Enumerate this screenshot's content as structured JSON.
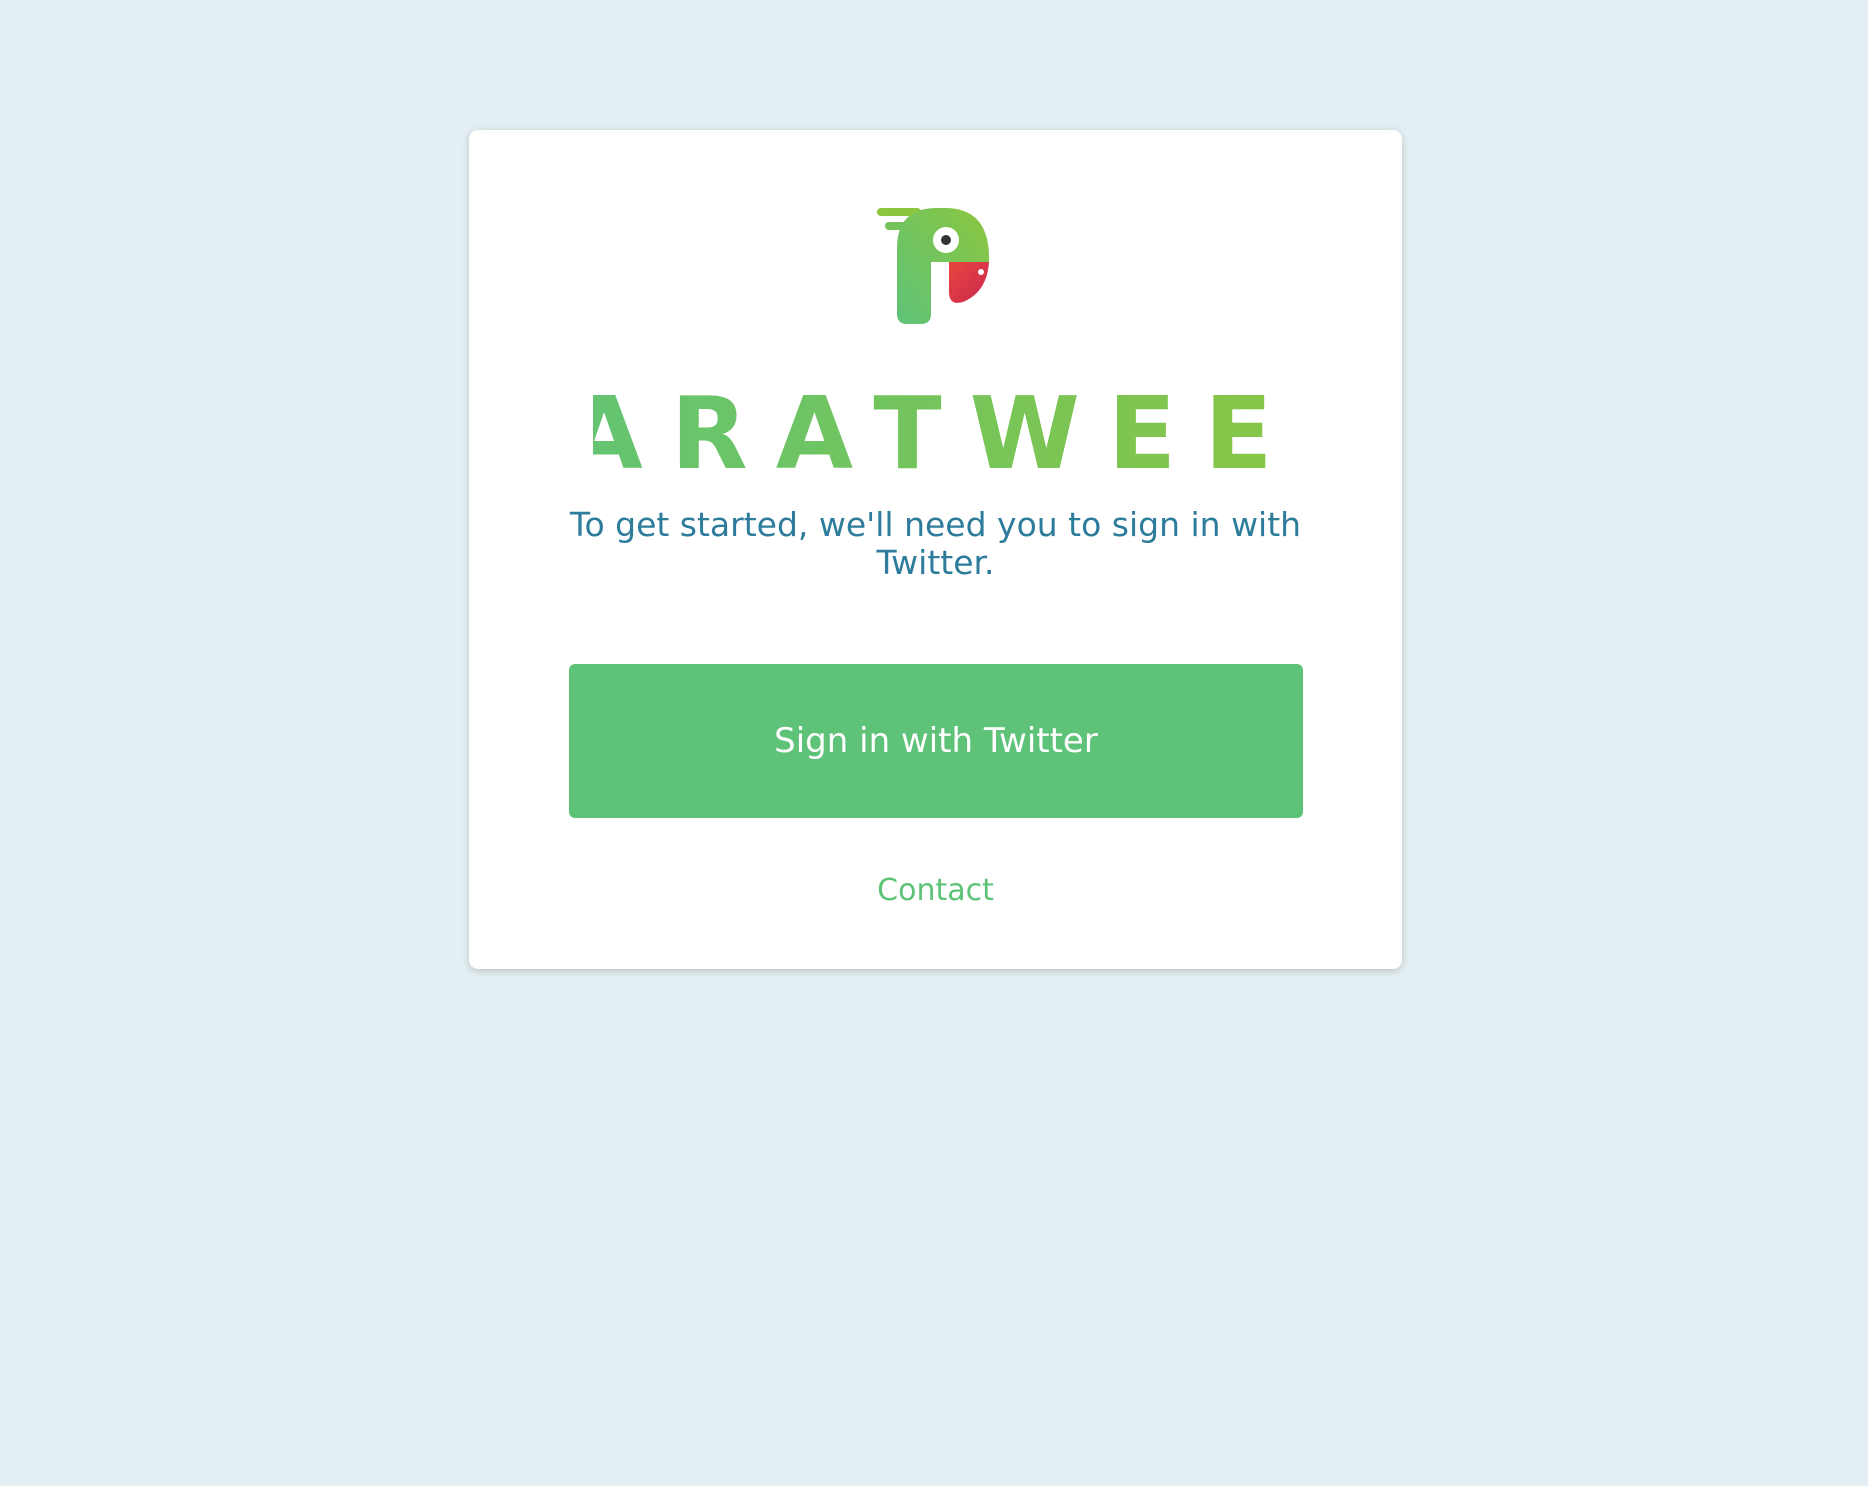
{
  "brand": {
    "name": "PARATWEET",
    "colors": {
      "green": "#5ec378",
      "lime": "#8cc63f",
      "red": "#d9334f",
      "text_blue": "#2e7c9c",
      "background": "#e3eff2"
    }
  },
  "login": {
    "message": "To get started, we'll need you to sign in with Twitter.",
    "signin_label": "Sign in with Twitter",
    "contact_label": "Contact"
  }
}
